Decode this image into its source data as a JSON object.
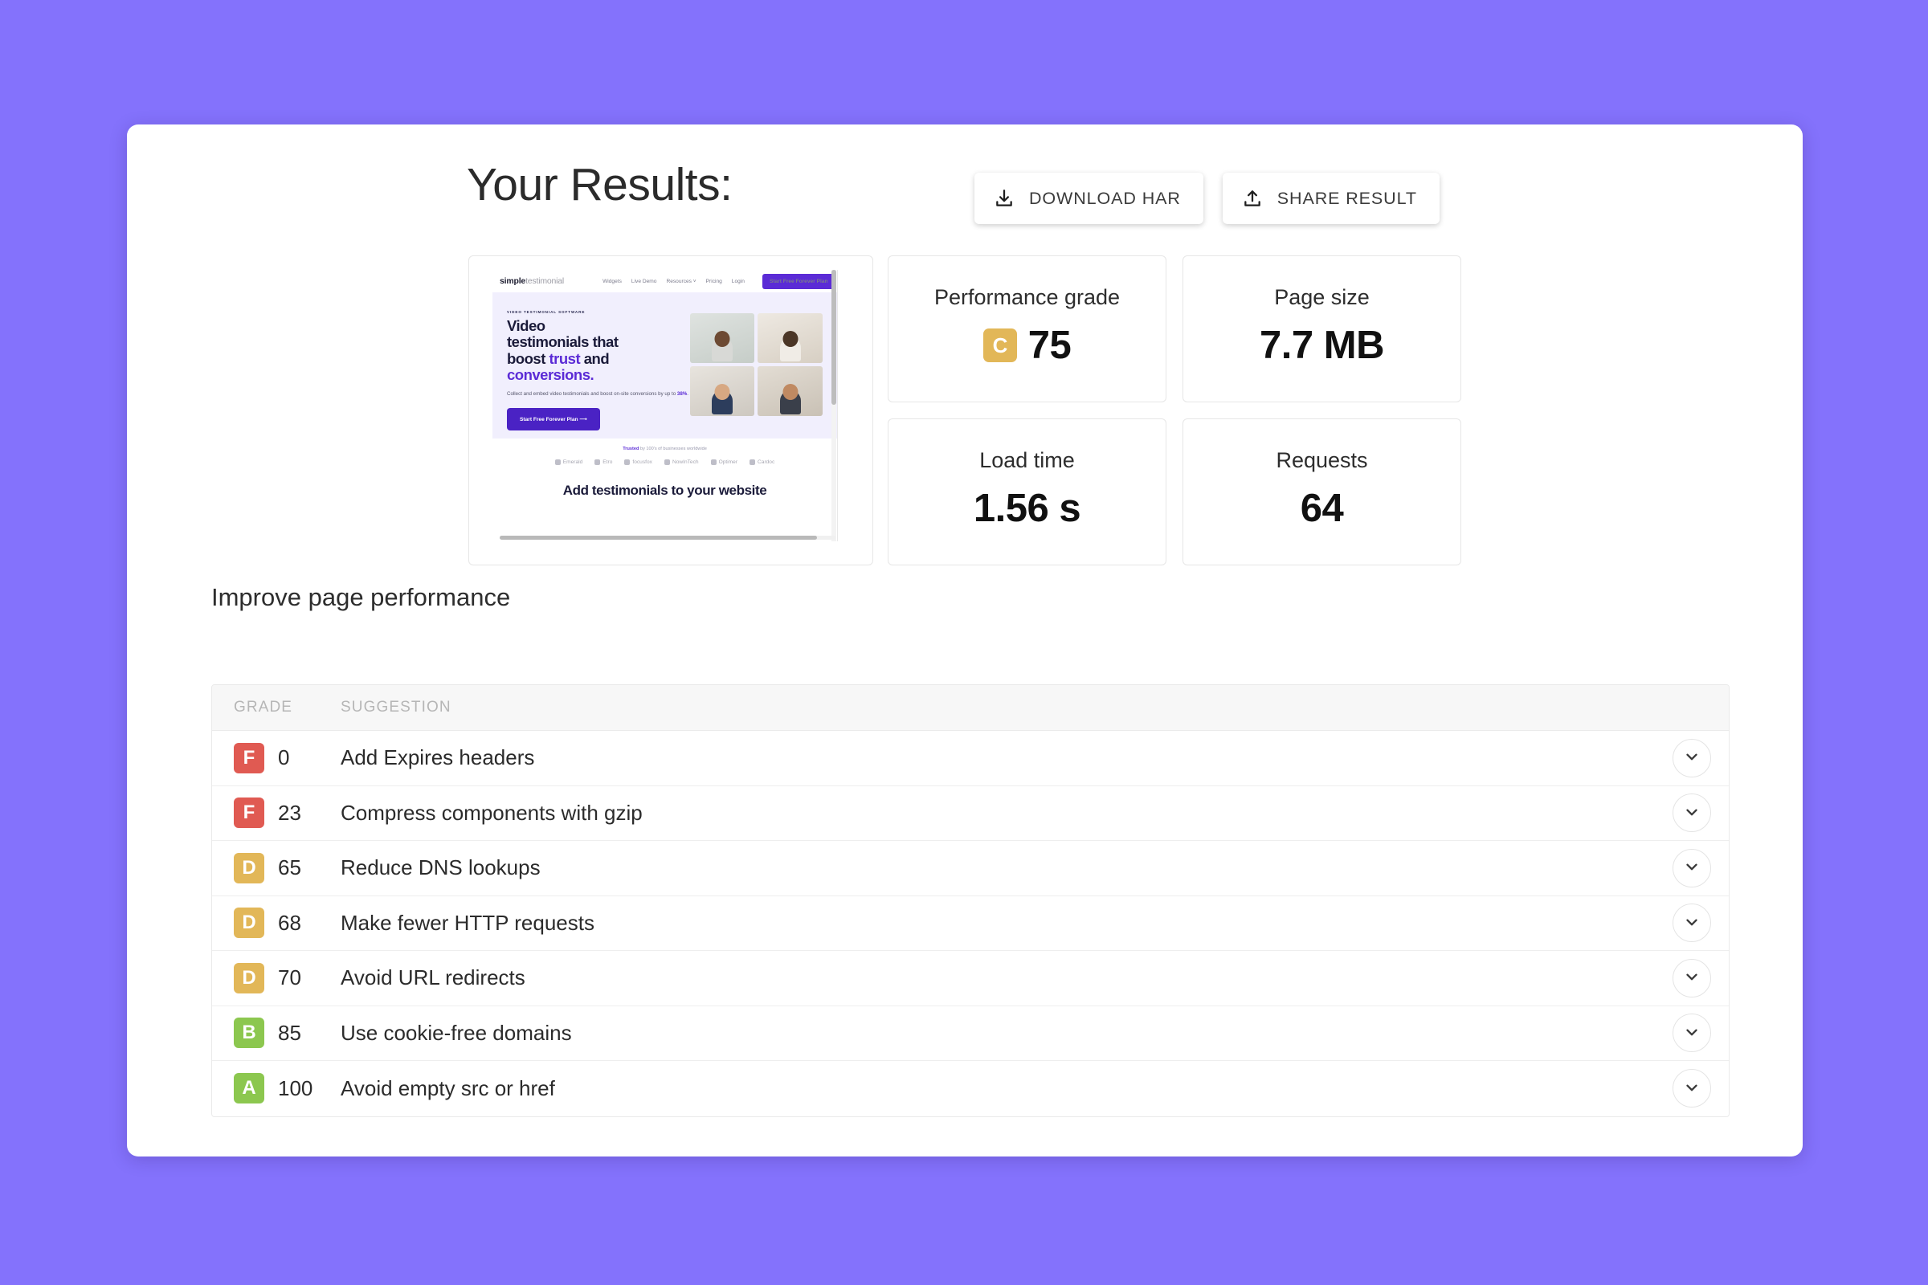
{
  "theme": {
    "background": "#8472fc",
    "panel": "#ffffff",
    "grade_colors": {
      "A": "#8cc74f",
      "B": "#8cc74f",
      "C": "#e2b758",
      "D": "#e2b758",
      "F": "#e05a52"
    }
  },
  "header": {
    "title": "Your Results:",
    "buttons": [
      {
        "label": "DOWNLOAD HAR",
        "icon": "download-icon"
      },
      {
        "label": "SHARE RESULT",
        "icon": "upload-share-icon"
      }
    ]
  },
  "metrics": [
    {
      "label": "Performance grade",
      "value": "75",
      "grade": "C",
      "has_grade": true
    },
    {
      "label": "Page size",
      "value": "7.7 MB",
      "grade": "",
      "has_grade": false
    },
    {
      "label": "Load time",
      "value": "1.56 s",
      "grade": "",
      "has_grade": false
    },
    {
      "label": "Requests",
      "value": "64",
      "grade": "",
      "has_grade": false
    }
  ],
  "thumbnail": {
    "alt": "website-screenshot-preview",
    "site": {
      "logo_prefix": "simple",
      "logo_suffix": "testimonial",
      "nav": [
        "Widgets",
        "Live Demo",
        "Resources ˅",
        "Pricing",
        "Login"
      ],
      "nav_cta": "Start Free Forever Plan",
      "eyebrow": "VIDEO TESTIMONIAL SOFTWARE",
      "headline_1": "Video",
      "headline_2": "testimonials that",
      "headline_3a": "boost ",
      "headline_3b": "trust",
      "headline_3c": " and",
      "headline_4": "conversions.",
      "subtext": "Collect and embed video testimonials and boost on-site conversions by up to ",
      "subtext_hl": "38%",
      "subtext_end": ".",
      "hero_cta": "Start Free Forever Plan ⟶",
      "trust_hl": "Trusted",
      "trust_rest": " by 100's of businesses worldwide",
      "logos": [
        "Emerald",
        "Etro",
        "focusfox",
        "NowInTech",
        "Optimer",
        "Cardoc"
      ],
      "section_title": "Add testimonials to your website"
    }
  },
  "improve": {
    "title": "Improve page performance",
    "columns": {
      "grade": "GRADE",
      "suggestion": "SUGGESTION"
    },
    "rows": [
      {
        "grade": "F",
        "score": "0",
        "suggestion": "Add Expires headers"
      },
      {
        "grade": "F",
        "score": "23",
        "suggestion": "Compress components with gzip"
      },
      {
        "grade": "D",
        "score": "65",
        "suggestion": "Reduce DNS lookups"
      },
      {
        "grade": "D",
        "score": "68",
        "suggestion": "Make fewer HTTP requests"
      },
      {
        "grade": "D",
        "score": "70",
        "suggestion": "Avoid URL redirects"
      },
      {
        "grade": "B",
        "score": "85",
        "suggestion": "Use cookie-free domains"
      },
      {
        "grade": "A",
        "score": "100",
        "suggestion": "Avoid empty src or href"
      }
    ]
  }
}
